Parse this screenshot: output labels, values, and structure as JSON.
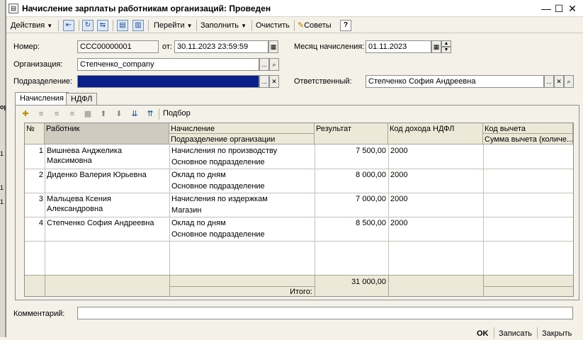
{
  "window": {
    "title": "Начисление зарплаты работникам организаций: Проведен",
    "icon_char": "⊟",
    "minimize_glyph": "—",
    "maximize_glyph": "☐",
    "close_glyph": "✕"
  },
  "toolbar": {
    "actions_label": "Действия",
    "goto_label": "Перейти",
    "fill_label": "Заполнить",
    "clear_label": "Очистить",
    "tips_label": "Советы",
    "help_glyph": "?"
  },
  "form": {
    "number_label": "Номер:",
    "number_value": "ССС00000001",
    "from_label": "от:",
    "date_value": "30.11.2023 23:59:59",
    "month_label": "Месяц начисления:",
    "month_value": "01.11.2023",
    "org_label": "Организация:",
    "org_value": "Степченко_company",
    "division_label": "Подразделение:",
    "division_value": "",
    "responsible_label": "Ответственный:",
    "responsible_value": "Степченко София Андреевна",
    "ellipsis": "...",
    "clear_glyph": "✕",
    "search_glyph": "🔍"
  },
  "tabs": [
    {
      "label": "Начисления"
    },
    {
      "label": "НДФЛ"
    }
  ],
  "subtoolbar": {
    "pick_label": "Подбор"
  },
  "table": {
    "headers": {
      "no": "№",
      "worker": "Работник",
      "accrual": "Начисление",
      "accrual_sub": "Подразделение организации",
      "result": "Результат",
      "ndfl_code": "Код дохода НДФЛ",
      "deduction_code": "Код вычета",
      "deduction_sub": "Сумма вычета (количе..."
    },
    "rows": [
      {
        "no": "1",
        "worker1": "Вишнева Анджелика",
        "worker2": "Максимовна",
        "accrual": "Начисления по производству",
        "division": "Основное подразделение",
        "result": "7 500,00",
        "code": "2000"
      },
      {
        "no": "2",
        "worker1": "Диденко Валерия Юрьевна",
        "worker2": "",
        "accrual": "Оклад по дням",
        "division": "Основное подразделение",
        "result": "8 000,00",
        "code": "2000"
      },
      {
        "no": "3",
        "worker1": "Мальцева Ксения",
        "worker2": "Александровна",
        "accrual": "Начисления по издержкам",
        "division": "Магазин",
        "result": "7 000,00",
        "code": "2000"
      },
      {
        "no": "4",
        "worker1": "Степченко София Андреевна",
        "worker2": "",
        "accrual": "Оклад по дням",
        "division": "Основное подразделение",
        "result": "8 500,00",
        "code": "2000"
      }
    ],
    "total_label": "Итого:",
    "total_value": "31 000,00"
  },
  "bottom": {
    "comment_label": "Комментарий:",
    "comment_value": "",
    "ok_label": "OK",
    "save_label": "Записать",
    "close_label": "Закрыть"
  },
  "background_strip": {
    "labels": [
      "ор",
      "1",
      "1",
      "1"
    ]
  }
}
